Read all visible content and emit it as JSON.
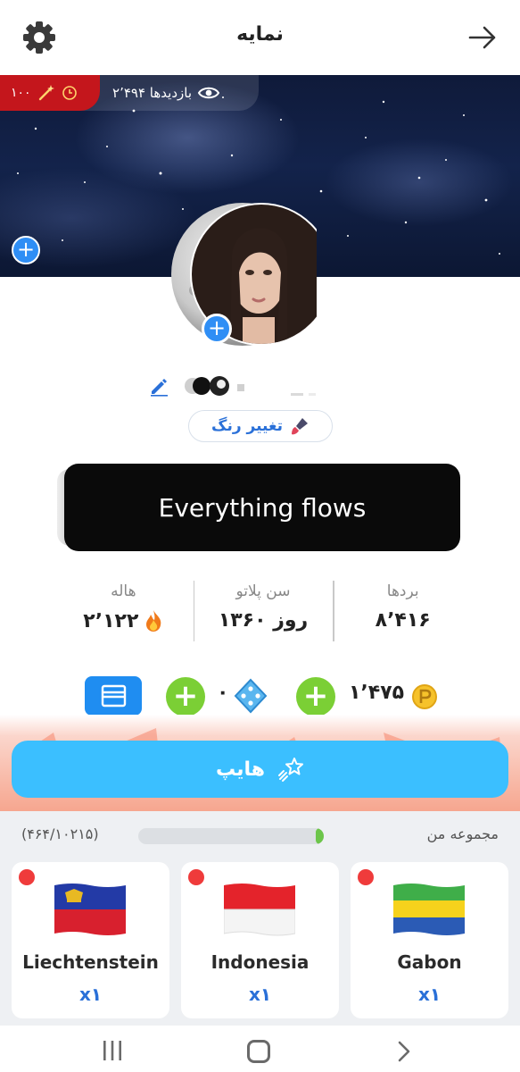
{
  "header": {
    "title": "نمایه",
    "settings_icon": "gear-icon",
    "back_icon": "arrow-right-icon"
  },
  "cover": {
    "timer_value": "۱۰۰",
    "views_text": "۲٬۴۹۴ بازدیدها"
  },
  "profile": {
    "change_color_label": "تغییر رنگ",
    "bio": "Everything flows"
  },
  "stats": [
    {
      "label": "بردها",
      "value": "۸٬۴۱۶"
    },
    {
      "label": "سن پلاتو",
      "value": "۱۳۶۰ روز"
    },
    {
      "label": "هاله",
      "value": "۲٬۱۲۲"
    }
  ],
  "currency": {
    "coins": "۱٬۴۷۵",
    "gems": "۰"
  },
  "hype": {
    "label": "هایپ"
  },
  "collection": {
    "title": "مجموعه من",
    "count_text": "(۴۶۴/۱۰۲۱۵)",
    "progress_fraction": 0.045,
    "cards": [
      {
        "name": "Gabon",
        "qty": "x۱"
      },
      {
        "name": "Indonesia",
        "qty": "x۱"
      },
      {
        "name": "Liechtenstein",
        "qty": "x۱"
      }
    ]
  },
  "colors": {
    "accent_blue": "#2f8ef5",
    "green": "#7bcf35",
    "hype_blue": "#3bbfff",
    "badge_red": "#c4161c"
  }
}
